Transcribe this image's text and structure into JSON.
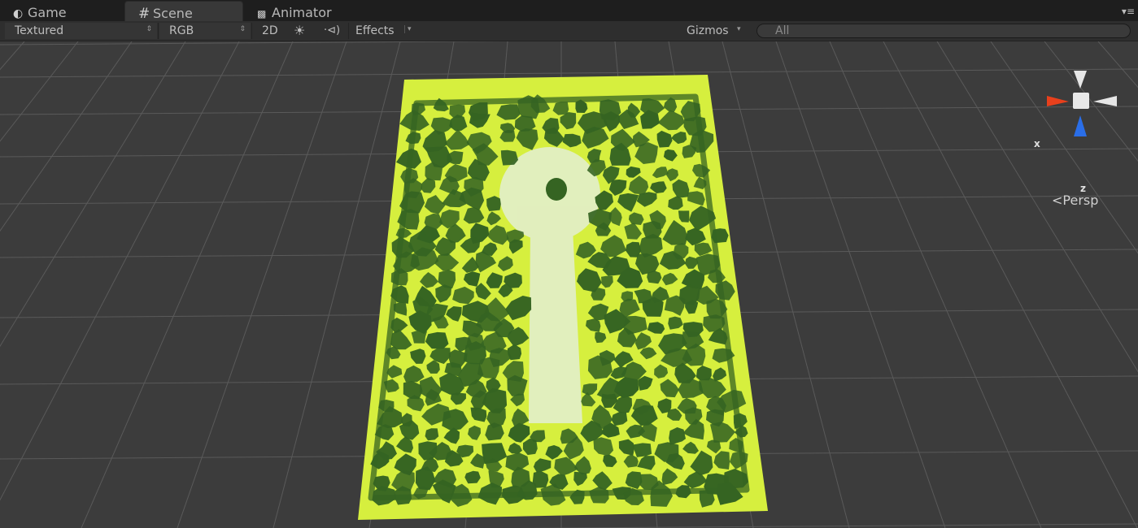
{
  "tabs": [
    {
      "label": "Game",
      "icon": "game-controller-icon",
      "active": false
    },
    {
      "label": "Scene",
      "icon": "grid-hash-icon",
      "active": true
    },
    {
      "label": "Animator",
      "icon": "animator-icon",
      "active": false
    }
  ],
  "toolbar": {
    "draw_mode": "Textured",
    "render_mode": "RGB",
    "mode_2d": "2D",
    "lighting_icon": "sun-icon",
    "audio_icon": "speaker-icon",
    "effects_label": "Effects",
    "gizmos_label": "Gizmos",
    "search_value": "All"
  },
  "gizmo": {
    "x_label": "x",
    "z_label": "z",
    "projection_label": "Persp",
    "colors": {
      "x": "#e8401c",
      "y": "#e6e6e6",
      "z": "#2a6ee8"
    }
  },
  "scene": {
    "ground_color": "#d6ef3e",
    "foliage_color": "#356422",
    "path_color": "#e3eed4",
    "grid_color": "#5a5a5a",
    "background": "#3c3c3c"
  }
}
